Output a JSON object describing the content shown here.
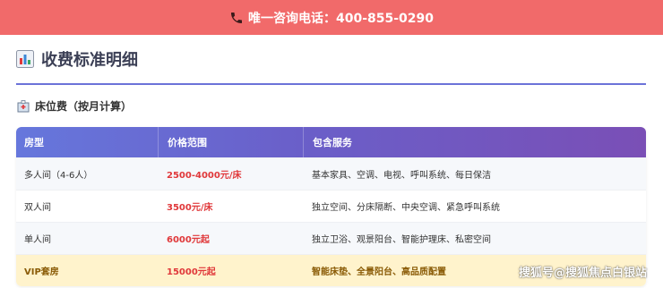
{
  "banner": {
    "text": "唯一咨询电话：400-855-0290",
    "bg": "#f16a6a"
  },
  "section": {
    "title": "收费标准明细",
    "icon": "bar-chart-icon"
  },
  "subsection": {
    "title": "床位费（按月计算）",
    "icon": "hospital-icon"
  },
  "table": {
    "headers": [
      "房型",
      "价格范围",
      "包含服务"
    ],
    "rows": [
      {
        "type": "多人间（4-6人）",
        "price": "2500-4000元/床",
        "services": "基本家具、空调、电视、呼叫系统、每日保洁"
      },
      {
        "type": "双人间",
        "price": "3500元/床",
        "services": "独立空间、分床隔断、中央空调、紧急呼叫系统"
      },
      {
        "type": "单人间",
        "price": "6000元起",
        "services": "独立卫浴、观景阳台、智能护理床、私密空间"
      },
      {
        "type": "VIP套房",
        "price": "15000元起",
        "services": "智能床垫、全景阳台、高品质配置"
      }
    ]
  },
  "watermark": "搜狐号@搜狐焦点白银站",
  "colors": {
    "accent": "#6b72d8",
    "price": "#e0383a",
    "vip_bg": "#fff3cc"
  }
}
